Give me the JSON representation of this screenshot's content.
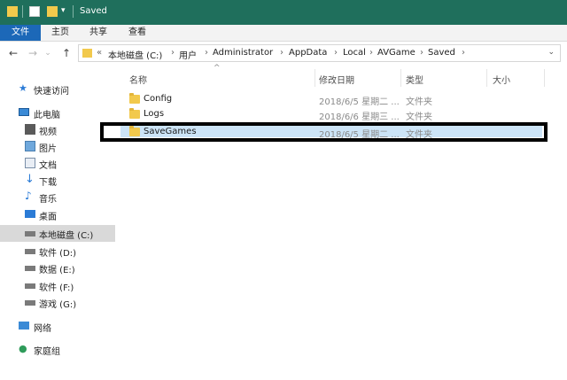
{
  "window": {
    "title": "Saved"
  },
  "ribbon": {
    "tabs": [
      "文件",
      "主页",
      "共享",
      "查看"
    ]
  },
  "address": {
    "overflow": "«",
    "crumbs": [
      "本地磁盘 (C:)",
      "用户",
      "Administrator",
      "AppData",
      "Local",
      "AVGame",
      "Saved"
    ],
    "separator": "›"
  },
  "sidebar": {
    "items": [
      {
        "label": "快速访问",
        "icon": "star-icon"
      },
      {
        "label": "此电脑",
        "icon": "computer-icon"
      },
      {
        "label": "视频",
        "icon": "video-icon"
      },
      {
        "label": "图片",
        "icon": "picture-icon"
      },
      {
        "label": "文档",
        "icon": "document-icon"
      },
      {
        "label": "下载",
        "icon": "download-icon"
      },
      {
        "label": "音乐",
        "icon": "music-icon"
      },
      {
        "label": "桌面",
        "icon": "desktop-icon"
      },
      {
        "label": "本地磁盘 (C:)",
        "icon": "drive-icon",
        "selected": true
      },
      {
        "label": "软件 (D:)",
        "icon": "drive-icon"
      },
      {
        "label": "数据 (E:)",
        "icon": "drive-icon"
      },
      {
        "label": "软件 (F:)",
        "icon": "drive-icon"
      },
      {
        "label": "游戏 (G:)",
        "icon": "drive-icon"
      },
      {
        "label": "网络",
        "icon": "network-icon"
      },
      {
        "label": "家庭组",
        "icon": "homegroup-icon"
      }
    ]
  },
  "columns": {
    "name": "名称",
    "date": "修改日期",
    "type": "类型",
    "size": "大小"
  },
  "files": [
    {
      "name": "Config",
      "date": "2018/6/5 星期二 ...",
      "type": "文件夹"
    },
    {
      "name": "Logs",
      "date": "2018/6/6 星期三 ...",
      "type": "文件夹"
    },
    {
      "name": "SaveGames",
      "date": "2018/6/5 星期二 ...",
      "type": "文件夹",
      "selected": true
    }
  ],
  "colors": {
    "titlebar": "#1f6f5c",
    "file_tab": "#1c68b8",
    "selection": "#cce4f7",
    "folder": "#f2c94c"
  }
}
